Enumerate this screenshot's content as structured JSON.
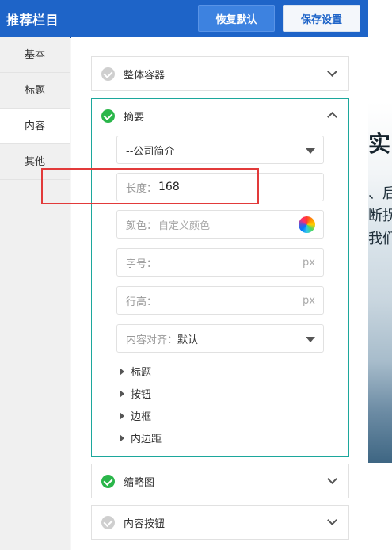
{
  "header": {
    "title": "推荐栏目",
    "reset_label": "恢复默认",
    "save_label": "保存设置"
  },
  "sidebar": {
    "items": [
      {
        "label": "基本"
      },
      {
        "label": "标题"
      },
      {
        "label": "内容"
      },
      {
        "label": "其他"
      }
    ],
    "active": "内容"
  },
  "sections": {
    "container": {
      "title": "整体容器",
      "enabled": false
    },
    "summary": {
      "title": "摘要",
      "enabled": true,
      "source_select": {
        "value": "--公司简介"
      },
      "length": {
        "label": "长度：",
        "value": "168"
      },
      "color": {
        "label": "颜色：",
        "placeholder": "自定义颜色"
      },
      "font_size": {
        "label": "字号：",
        "value": "",
        "unit": "px"
      },
      "line_height": {
        "label": "行高：",
        "value": "",
        "unit": "px"
      },
      "align": {
        "label": "内容对齐：",
        "value": "默认"
      },
      "sub_items": [
        {
          "label": "标题"
        },
        {
          "label": "按钮"
        },
        {
          "label": "边框"
        },
        {
          "label": "内边距"
        }
      ]
    },
    "thumbnail": {
      "title": "缩略图",
      "enabled": true
    },
    "content_button": {
      "title": "内容按钮",
      "enabled": false
    }
  },
  "preview": {
    "lines": [
      "实",
      "、后",
      "断拐",
      "我们"
    ]
  },
  "colors": {
    "header": "#1e64c8",
    "accent_border": "#1ca79c",
    "check_on": "#2ab64a",
    "highlight": "#e23a3a"
  }
}
